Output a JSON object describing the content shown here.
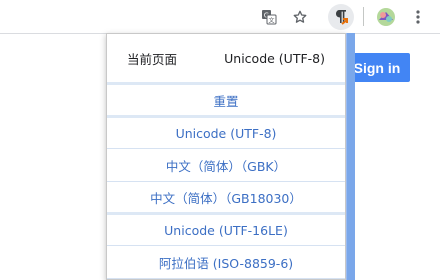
{
  "toolbar": {
    "translate_icon": "translate-icon",
    "star_icon": "star-icon",
    "extension_icon": "pilcrow-icon",
    "profile_icon": "profile-avatar",
    "menu_icon": "kebab-menu-icon"
  },
  "page": {
    "sign_in_label": "Sign in"
  },
  "popup": {
    "current_page_label": "当前页面",
    "current_encoding": "Unicode (UTF-8)",
    "reset_label": "重置",
    "items": [
      {
        "label": "Unicode (UTF-8)"
      },
      {
        "label": "中文（简体）（GBK）"
      },
      {
        "label": "中文（简体）（GB18030）"
      },
      {
        "label": "Unicode (UTF-16LE)"
      },
      {
        "label": "阿拉伯语 (ISO-8859-6)"
      }
    ]
  },
  "colors": {
    "accent": "#4285f4",
    "link_text": "#3c6fc4",
    "scrollbar": "#7aa7ea"
  }
}
